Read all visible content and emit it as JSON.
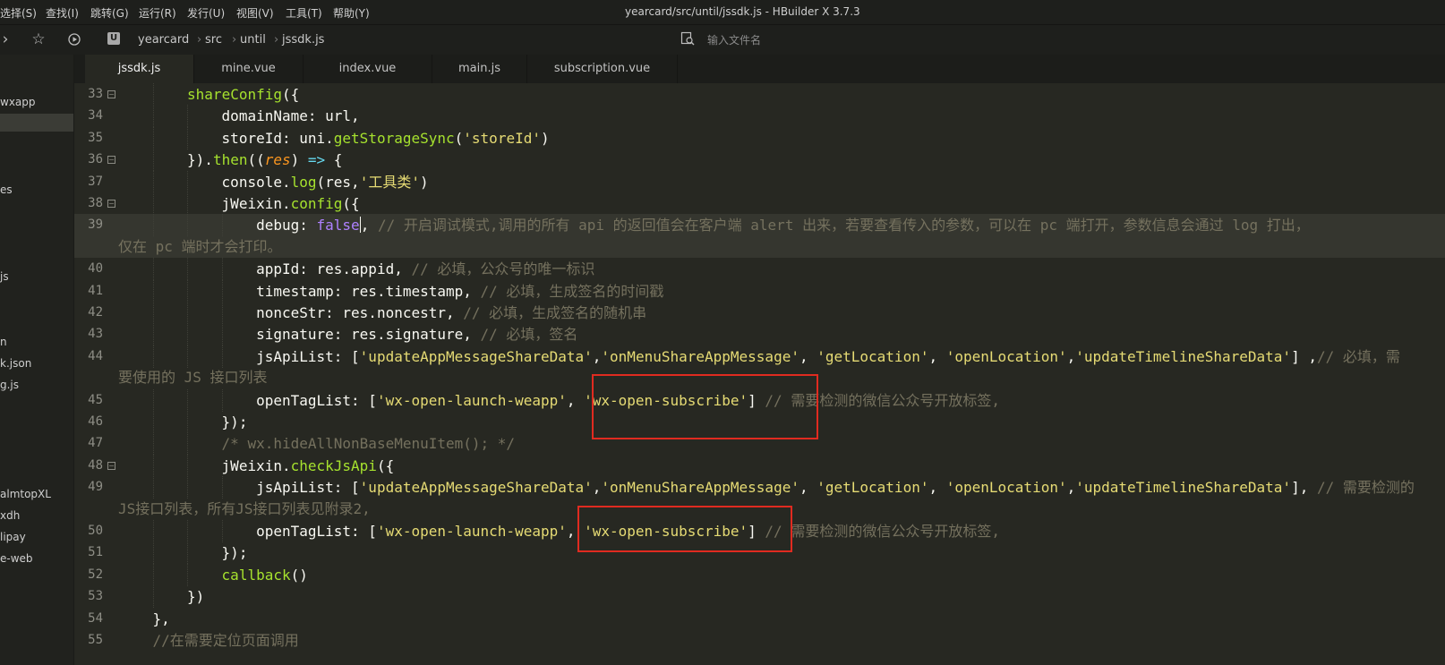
{
  "window": {
    "title": "yearcard/src/until/jssdk.js - HBuilder X 3.7.3",
    "menu": [
      "选择(S)",
      "查找(I)",
      "跳转(G)",
      "运行(R)",
      "发行(U)",
      "视图(V)",
      "工具(T)",
      "帮助(Y)"
    ]
  },
  "toolbar": {
    "home_icon_label": "U",
    "breadcrumb": [
      "yearcard",
      "src",
      "until",
      "jssdk.js"
    ],
    "file_search_placeholder": "输入文件名"
  },
  "sidebar": {
    "items": [
      "wxapp",
      "",
      "es",
      "js",
      "n",
      "k.json",
      "g.js",
      "almtopXL",
      "xdh",
      "lipay",
      "e-web"
    ]
  },
  "tabs": [
    {
      "label": "jssdk.js",
      "active": true
    },
    {
      "label": "mine.vue",
      "active": false
    },
    {
      "label": "index.vue",
      "active": false
    },
    {
      "label": "main.js",
      "active": false
    },
    {
      "label": "subscription.vue",
      "active": false
    }
  ],
  "editor": {
    "lines": [
      {
        "n": "33",
        "fold": true,
        "indent": 2,
        "tokens": [
          [
            "fn",
            "shareConfig"
          ],
          [
            "p",
            "({"
          ]
        ]
      },
      {
        "n": "34",
        "indent": 3,
        "tokens": [
          [
            "p",
            "domainName: url,"
          ]
        ]
      },
      {
        "n": "35",
        "indent": 3,
        "tokens": [
          [
            "p",
            "storeId: uni."
          ],
          [
            "fn",
            "getStorageSync"
          ],
          [
            "p",
            "("
          ],
          [
            "str",
            "'storeId'"
          ],
          [
            "p",
            ")"
          ]
        ]
      },
      {
        "n": "36",
        "fold": true,
        "indent": 2,
        "tokens": [
          [
            "p",
            "})."
          ],
          [
            "fn",
            "then"
          ],
          [
            "p",
            "(("
          ],
          [
            "arg",
            "res"
          ],
          [
            "p",
            ") "
          ],
          [
            "op",
            "=>"
          ],
          [
            "p",
            " {"
          ]
        ]
      },
      {
        "n": "37",
        "indent": 3,
        "tokens": [
          [
            "p",
            "console."
          ],
          [
            "fn",
            "log"
          ],
          [
            "p",
            "(res,"
          ],
          [
            "str",
            "'工具类'"
          ],
          [
            "p",
            ")"
          ]
        ]
      },
      {
        "n": "38",
        "fold": true,
        "indent": 3,
        "tokens": [
          [
            "p",
            "jWeixin."
          ],
          [
            "fn",
            "config"
          ],
          [
            "p",
            "({"
          ]
        ]
      },
      {
        "n": "39",
        "indent": 4,
        "current": true,
        "tokens": [
          [
            "p",
            "debug: "
          ],
          [
            "kw",
            "false"
          ],
          [
            "caret",
            ""
          ],
          [
            "p",
            ", "
          ],
          [
            "cm",
            "// 开启调试模式,调用的所有 api 的返回值会在客户端 alert 出来，若要查看传入的参数，可以在 pc 端打开，参数信息会通过 log 打出，"
          ]
        ],
        "cont": [
          [
            "cm",
            "仅在 pc 端时才会打印。"
          ]
        ]
      },
      {
        "n": "40",
        "indent": 4,
        "tokens": [
          [
            "p",
            "appId: res.appid, "
          ],
          [
            "cm",
            "// 必填，公众号的唯一标识"
          ]
        ]
      },
      {
        "n": "41",
        "indent": 4,
        "tokens": [
          [
            "p",
            "timestamp: res.timestamp, "
          ],
          [
            "cm",
            "// 必填，生成签名的时间戳"
          ]
        ]
      },
      {
        "n": "42",
        "indent": 4,
        "tokens": [
          [
            "p",
            "nonceStr: res.noncestr, "
          ],
          [
            "cm",
            "// 必填，生成签名的随机串"
          ]
        ]
      },
      {
        "n": "43",
        "indent": 4,
        "tokens": [
          [
            "p",
            "signature: res.signature, "
          ],
          [
            "cm",
            "// 必填，签名"
          ]
        ]
      },
      {
        "n": "44",
        "indent": 4,
        "tokens": [
          [
            "p",
            "jsApiList: ["
          ],
          [
            "str",
            "'updateAppMessageShareData'"
          ],
          [
            "p",
            ","
          ],
          [
            "str",
            "'onMenuShareAppMessage'"
          ],
          [
            "p",
            ", "
          ],
          [
            "str",
            "'getLocation'"
          ],
          [
            "p",
            ", "
          ],
          [
            "str",
            "'openLocation'"
          ],
          [
            "p",
            ","
          ],
          [
            "str",
            "'updateTimelineShareData'"
          ],
          [
            "p",
            "] ,"
          ],
          [
            "cm",
            "// 必填，需"
          ]
        ],
        "cont": [
          [
            "cm",
            "要使用的 JS 接口列表"
          ]
        ]
      },
      {
        "n": "45",
        "indent": 4,
        "tokens": [
          [
            "p",
            "openTagList: ["
          ],
          [
            "str",
            "'wx-open-launch-weapp'"
          ],
          [
            "p",
            ", "
          ],
          [
            "str",
            "'wx-open-subscribe'"
          ],
          [
            "p",
            "] "
          ],
          [
            "cm",
            "// 需要检测的微信公众号开放标签,"
          ]
        ]
      },
      {
        "n": "46",
        "indent": 3,
        "tokens": [
          [
            "p",
            "});"
          ]
        ]
      },
      {
        "n": "47",
        "indent": 3,
        "tokens": [
          [
            "cm",
            "/* wx.hideAllNonBaseMenuItem(); */"
          ]
        ]
      },
      {
        "n": "48",
        "fold": true,
        "indent": 3,
        "tokens": [
          [
            "p",
            "jWeixin."
          ],
          [
            "fn",
            "checkJsApi"
          ],
          [
            "p",
            "({"
          ]
        ]
      },
      {
        "n": "49",
        "indent": 4,
        "tokens": [
          [
            "p",
            "jsApiList: ["
          ],
          [
            "str",
            "'updateAppMessageShareData'"
          ],
          [
            "p",
            ","
          ],
          [
            "str",
            "'onMenuShareAppMessage'"
          ],
          [
            "p",
            ", "
          ],
          [
            "str",
            "'getLocation'"
          ],
          [
            "p",
            ", "
          ],
          [
            "str",
            "'openLocation'"
          ],
          [
            "p",
            ","
          ],
          [
            "str",
            "'updateTimelineShareData'"
          ],
          [
            "p",
            "], "
          ],
          [
            "cm",
            "// 需要检测的"
          ]
        ],
        "cont": [
          [
            "cm",
            "JS接口列表，所有JS接口列表见附录2,"
          ]
        ]
      },
      {
        "n": "50",
        "indent": 4,
        "tokens": [
          [
            "p",
            "openTagList: ["
          ],
          [
            "str",
            "'wx-open-launch-weapp'"
          ],
          [
            "p",
            ", "
          ],
          [
            "str",
            "'wx-open-subscribe'"
          ],
          [
            "p",
            "] "
          ],
          [
            "cm",
            "// 需要检测的微信公众号开放标签,"
          ]
        ]
      },
      {
        "n": "51",
        "indent": 3,
        "tokens": [
          [
            "p",
            "});"
          ]
        ]
      },
      {
        "n": "52",
        "indent": 3,
        "tokens": [
          [
            "fn",
            "callback"
          ],
          [
            "p",
            "()"
          ]
        ]
      },
      {
        "n": "53",
        "indent": 2,
        "tokens": [
          [
            "p",
            "})"
          ]
        ]
      },
      {
        "n": "54",
        "indent": 1,
        "tokens": [
          [
            "p",
            "},"
          ]
        ]
      },
      {
        "n": "55",
        "indent": 1,
        "tokens": [
          [
            "cm",
            "//在需要定位页面调用"
          ]
        ]
      }
    ]
  },
  "colors": {
    "background": "#272822",
    "function": "#a6e22e",
    "string": "#e6db74",
    "comment": "#75715e",
    "keyword": "#ae81ff",
    "annotation_box": "#e02b20"
  }
}
